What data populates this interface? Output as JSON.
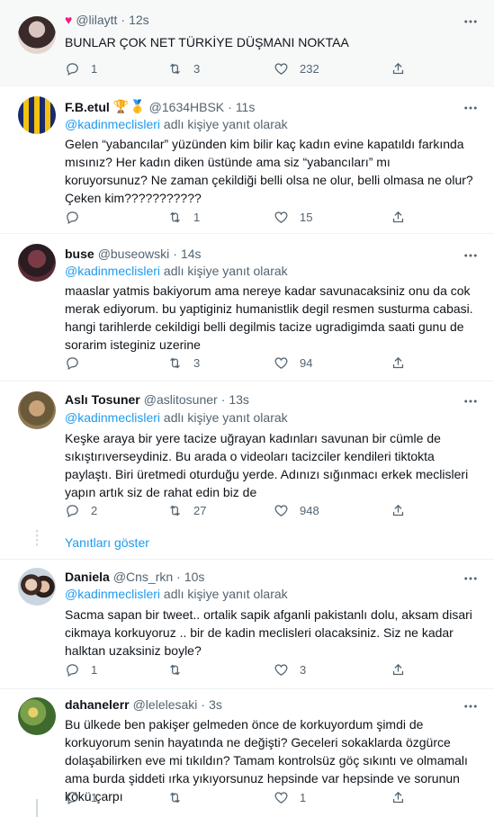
{
  "tweets": [
    {
      "name": "",
      "heart": "♥",
      "handle": "@lilaytt",
      "time": "12s",
      "replying_mention": "",
      "replying_suffix": "",
      "text": "BUNLAR ÇOK NET TÜRKİYE DÜŞMANI NOKTAA",
      "reply_count": "1",
      "retweet_count": "3",
      "like_count": "232"
    },
    {
      "name": "F.B.etul",
      "badges": [
        "🏆",
        "🥇"
      ],
      "handle": "@1634HBSK",
      "time": "11s",
      "replying_mention": "@kadinmeclisleri",
      "replying_suffix": " adlı kişiye yanıt olarak",
      "text": "Gelen “yabancılar” yüzünden kim bilir kaç kadın evine kapatıldı farkında mısınız? Her kadın diken üstünde ama siz “yabancıları” mı koruyorsunuz? Ne zaman çekildiği belli olsa ne olur, belli olmasa ne olur? Çeken kim???????????",
      "reply_count": "",
      "retweet_count": "1",
      "like_count": "15"
    },
    {
      "name": "buse",
      "handle": "@buseowski",
      "time": "14s",
      "replying_mention": "@kadinmeclisleri",
      "replying_suffix": " adlı kişiye yanıt olarak",
      "text": "maaslar yatmis bakiyorum ama nereye kadar savunacaksiniz onu da cok merak ediyorum. bu yaptiginiz humanistlik degil resmen susturma cabasi. hangi tarihlerde cekildigi belli degilmis tacize ugradigimda saati gunu de sorarim isteginiz uzerine",
      "reply_count": "",
      "retweet_count": "3",
      "like_count": "94"
    },
    {
      "name": "Aslı Tosuner",
      "handle": "@aslitosuner",
      "time": "13s",
      "replying_mention": "@kadinmeclisleri",
      "replying_suffix": " adlı kişiye yanıt olarak",
      "text": "Keşke araya bir yere tacize uğrayan kadınları savunan bir cümle de sıkıştırıverseydiniz. Bu arada o videoları tacizciler kendileri tiktokta paylaştı. Biri üretmedi oturduğu yerde. Adınızı sığınmacı erkek meclisleri yapın artık siz de rahat edin biz de",
      "reply_count": "2",
      "retweet_count": "27",
      "like_count": "948"
    },
    {
      "name": "Daniela",
      "handle": "@Cns_rkn",
      "time": "10s",
      "replying_mention": "@kadinmeclisleri",
      "replying_suffix": " adlı kişiye yanıt olarak",
      "text": "Sacma sapan bir tweet.. ortalik sapik afganli pakistanlı dolu, aksam disari cikmaya korkuyoruz .. bir de kadin meclisleri olacaksiniz. Siz ne kadar halktan uzaksiniz boyle?",
      "reply_count": "1",
      "retweet_count": "",
      "like_count": "3"
    },
    {
      "name": "dahanelerr",
      "handle": "@lelelesaki",
      "time": "3s",
      "replying_mention": "",
      "replying_suffix": "",
      "text": "Bu ülkede ben pakişer gelmeden önce de korkuyordum şimdi de korkuyorum senin hayatında ne değişti? Geceleri sokaklarda özgürce dolaşabilirken eve mi tıkıldın? Tamam kontrolsüz göç sıkıntı ve olmamalı ama burda şiddeti ırka yıkıyorsunuz hepsinde var hepsinde ve sorunun kökü çarpı",
      "reply_count": "1",
      "retweet_count": "",
      "like_count": "1"
    }
  ],
  "show_replies": "Yanıtları göster",
  "colors": {
    "accent": "#1d9bf0",
    "muted": "#536471",
    "text": "#0f1419",
    "border": "#eff3f4",
    "heart": "#f91880"
  }
}
